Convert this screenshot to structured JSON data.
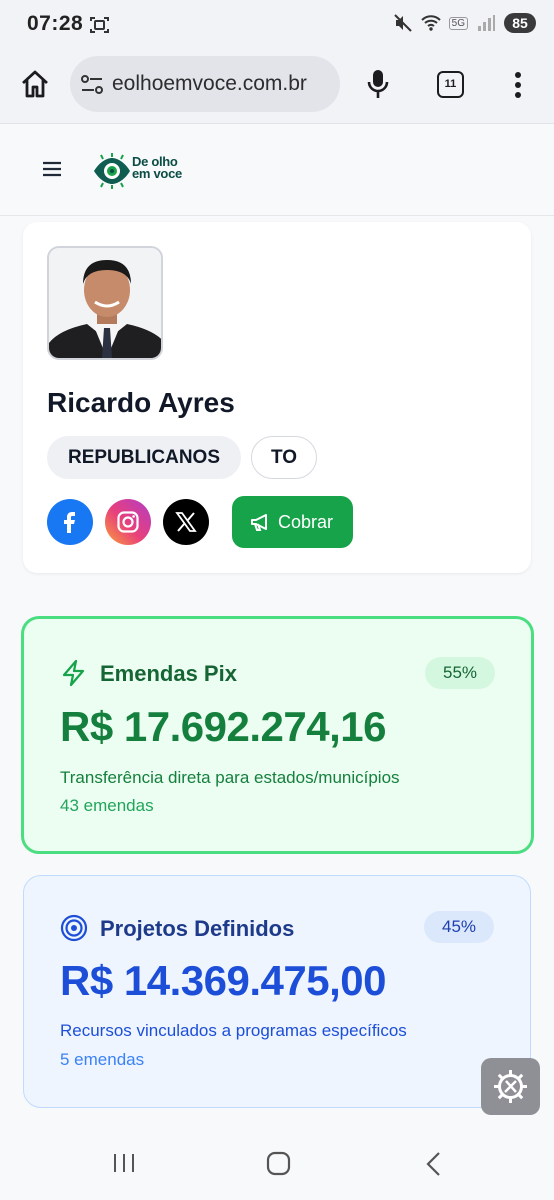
{
  "status_bar": {
    "time": "07:28",
    "network": "5G",
    "battery": "85",
    "icons": [
      "screenshot-icon",
      "mute-icon",
      "wifi-icon",
      "signal-icon",
      "battery-icon"
    ]
  },
  "browser": {
    "url": "eolhoemvoce.com.br",
    "tab_count": "11",
    "icons": [
      "home-icon",
      "site-info-icon",
      "mic-icon",
      "tabs-icon",
      "more-vert-icon"
    ]
  },
  "site": {
    "logo_line1": "De olho",
    "logo_line2": "em voce",
    "logo_color": "#0b4d44",
    "menu_icon": "hamburger-icon"
  },
  "profile": {
    "name": "Ricardo Ayres",
    "party": "REPUBLICANOS",
    "state": "TO",
    "socials": [
      "facebook-icon",
      "instagram-icon",
      "x-icon"
    ],
    "cobrar_label": "Cobrar"
  },
  "cards": {
    "pix": {
      "title": "Emendas Pix",
      "percent": "55%",
      "value": "R$ 17.692.274,16",
      "description": "Transferência direta para estados/municípios",
      "count": "43 emendas",
      "icon": "lightning-icon",
      "accent": "#16a34a"
    },
    "projetos": {
      "title": "Projetos Definidos",
      "percent": "45%",
      "value": "R$ 14.369.475,00",
      "description": "Recursos vinculados a programas específicos",
      "count": "5 emendas",
      "icon": "target-icon",
      "accent": "#1d4ed8"
    }
  },
  "system_nav": [
    "recents-icon",
    "home-circle-icon",
    "back-icon"
  ]
}
